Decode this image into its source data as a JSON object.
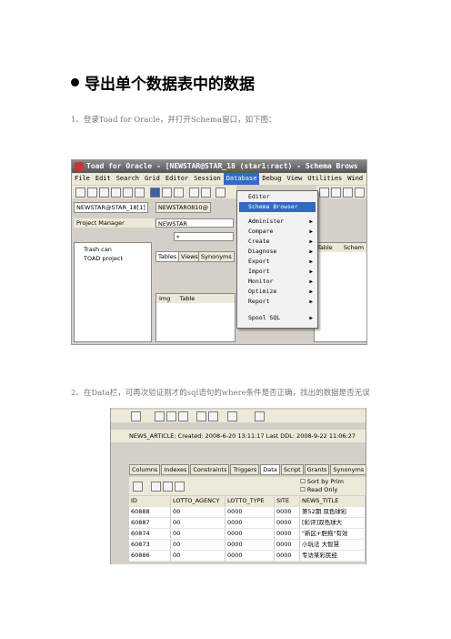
{
  "heading": "导出单个数据表中的数据",
  "step1": "1、登录Toad for Oracle，并打开Schema窗口，如下图：",
  "step2": "2、在Data栏，可再次验证刚才的sql语句的where条件是否正确，找出的数据是否无误",
  "screenshot1": {
    "title": "Toad for Oracle - [NEWSTAR@STAR_18 (star1:ract) - Schema Brows",
    "menu": [
      "File",
      "Edit",
      "Search",
      "Grid",
      "Editor",
      "Session",
      "Database",
      "Debug",
      "View",
      "Utilities",
      "Wind"
    ],
    "active_menu": "Database",
    "session_tab": "NEWSTAR@STAR_18[1]",
    "session_tab2": "NEWSTAR0810@",
    "project_manager_title": "Project Manager",
    "project_items": [
      "Trash can",
      "TOAD project"
    ],
    "schema_value": "NEWSTAR",
    "filter_value": "*",
    "object_tabs": [
      "Tables",
      "Views",
      "Synonyms"
    ],
    "list_columns": [
      "Img",
      "Table"
    ],
    "right_columns": [
      "Table",
      "Schem"
    ],
    "dropdown_items": [
      {
        "label": "Editor",
        "submenu": false
      },
      {
        "label": "Schema Browser",
        "submenu": false,
        "selected": true
      },
      {
        "label": "Administer",
        "submenu": true
      },
      {
        "label": "Compare",
        "submenu": true
      },
      {
        "label": "Create",
        "submenu": true
      },
      {
        "label": "Diagnose",
        "submenu": true
      },
      {
        "label": "Export",
        "submenu": true
      },
      {
        "label": "Import",
        "submenu": true
      },
      {
        "label": "Monitor",
        "submenu": true
      },
      {
        "label": "Optimize",
        "submenu": true
      },
      {
        "label": "Report",
        "submenu": true
      },
      {
        "label": "Spool SQL",
        "submenu": true
      }
    ]
  },
  "screenshot2": {
    "info_line": "NEWS_ARTICLE:  Created: 2008-6-20 13:11:17   Last DDL: 2008-9-22 11:06:27",
    "tabs": [
      "Columns",
      "Indexes",
      "Constraints",
      "Triggers",
      "Data",
      "Script",
      "Grants",
      "Synonyms"
    ],
    "active_tab": "Data",
    "checkboxes": [
      "Sort by Prim",
      "Read Only"
    ],
    "columns": [
      "ID",
      "LOTTO_AGENCY",
      "LOTTO_TYPE",
      "SITE",
      "NEWS_TITLE"
    ],
    "rows": [
      [
        "60888",
        "00",
        "0000",
        "0000",
        "第52期 双色球彩"
      ],
      [
        "60887",
        "00",
        "0000",
        "0000",
        "[彩评]双色球大"
      ],
      [
        "60874",
        "00",
        "0000",
        "0000",
        "\"新区+胆拖\"有效"
      ],
      [
        "60873",
        "00",
        "0000",
        "0000",
        "小玩法 大智慧"
      ],
      [
        "60886",
        "00",
        "0000",
        "0000",
        "专访某彩民经"
      ]
    ]
  }
}
